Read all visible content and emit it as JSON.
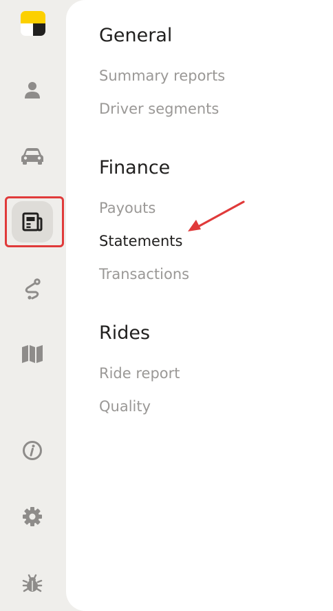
{
  "sidebar": {
    "items": [
      {
        "icon": "user-icon"
      },
      {
        "icon": "car-icon"
      },
      {
        "icon": "reports-icon",
        "active": true
      },
      {
        "icon": "route-icon"
      },
      {
        "icon": "map-icon"
      },
      {
        "icon": "info-icon"
      },
      {
        "icon": "gear-icon"
      },
      {
        "icon": "bug-icon"
      }
    ]
  },
  "menu": {
    "general": {
      "title": "General",
      "items": [
        "Summary reports",
        "Driver segments"
      ]
    },
    "finance": {
      "title": "Finance",
      "items": [
        "Payouts",
        "Statements",
        "Transactions"
      ]
    },
    "rides": {
      "title": "Rides",
      "items": [
        "Ride report",
        "Quality"
      ]
    }
  },
  "colors": {
    "brand_yellow": "#fcd000",
    "highlight_red": "#e03a3a",
    "active_text": "#21201f",
    "inactive_text": "#9a9896"
  }
}
